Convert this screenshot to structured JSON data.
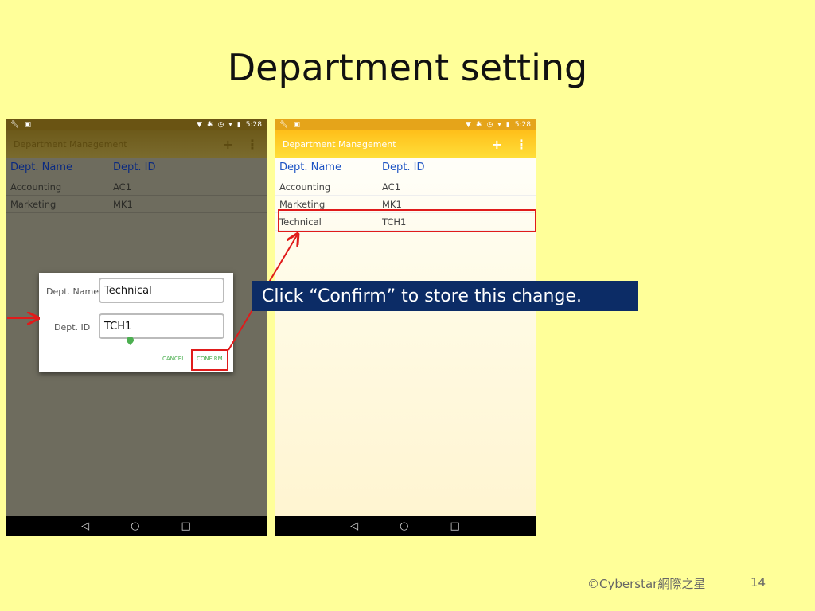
{
  "slide": {
    "title": "Department setting",
    "callout": "Click “Confirm” to store this change.",
    "footer_copyright": "©Cyberstar網際之星",
    "page_number": "14"
  },
  "status_bar": {
    "time": "5:28",
    "left_icons": [
      "wrench-icon",
      "screenshot-icon"
    ],
    "right_icons": [
      "location-icon",
      "bluetooth-icon",
      "clock-icon",
      "wifi-icon",
      "battery-icon"
    ]
  },
  "app": {
    "title": "Department Management",
    "add_icon": "+",
    "overflow_icon": "⋮",
    "columns": [
      "Dept. Name",
      "Dept. ID"
    ]
  },
  "left_phone": {
    "rows": [
      {
        "name": "Accounting",
        "id": "AC1"
      },
      {
        "name": "Marketing",
        "id": "MK1"
      }
    ],
    "dialog": {
      "name_label": "Dept. Name",
      "name_value": "Technical",
      "id_label": "Dept. ID",
      "id_value": "TCH1",
      "cancel_label": "CANCEL",
      "confirm_label": "CONFIRM"
    }
  },
  "right_phone": {
    "rows": [
      {
        "name": "Accounting",
        "id": "AC1"
      },
      {
        "name": "Marketing",
        "id": "MK1"
      },
      {
        "name": "Technical",
        "id": "TCH1"
      }
    ]
  },
  "navbar": {
    "back": "◁",
    "home": "○",
    "recents": "□"
  },
  "colors": {
    "highlight": "#e01b1b",
    "callout_bg": "#0c2c66",
    "slide_bg": "#ffff99",
    "app_bar": "#ffc61f"
  }
}
